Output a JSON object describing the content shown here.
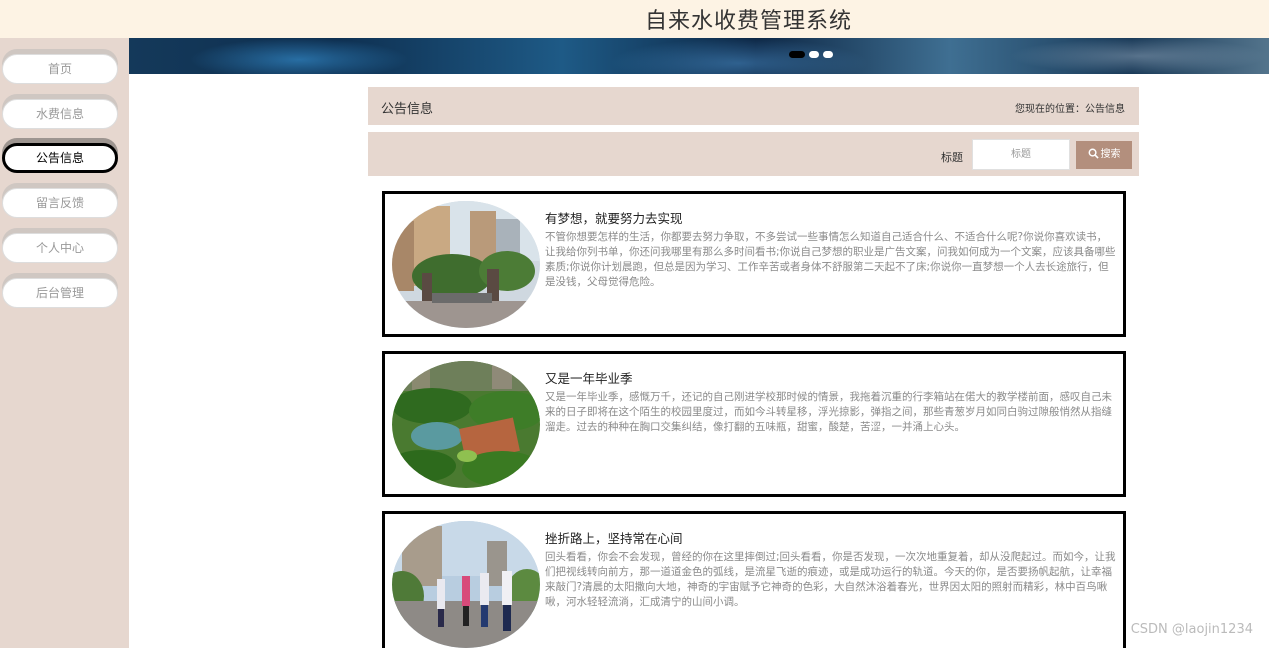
{
  "header": {
    "title": "自来水收费管理系统"
  },
  "sidebar": {
    "items": [
      {
        "label": "首页"
      },
      {
        "label": "水费信息"
      },
      {
        "label": "公告信息"
      },
      {
        "label": "留言反馈"
      },
      {
        "label": "个人中心"
      },
      {
        "label": "后台管理"
      }
    ],
    "active_index": 2
  },
  "banner": {
    "slide_count": 3,
    "active_slide": 1
  },
  "breadcrumb": {
    "title": "公告信息",
    "location": "您现在的位置：公告信息"
  },
  "search": {
    "label": "标题",
    "placeholder": "标题",
    "button_label": "搜索"
  },
  "articles": [
    {
      "title": "有梦想，就要努力去实现",
      "excerpt": "不管你想要怎样的生活，你都要去努力争取，不多尝试一些事情怎么知道自己适合什么、不适合什么呢?你说你喜欢读书，让我给你列书单，你还问我哪里有那么多时间看书;你说自己梦想的职业是广告文案，问我如何成为一个文案，应该具备哪些素质;你说你计划晨跑，但总是因为学习、工作辛苦或者身体不舒服第二天起不了床;你说你一直梦想一个人去长途旅行，但是没钱，父母觉得危险。",
      "image": "residential-gate-photo"
    },
    {
      "title": "又是一年毕业季",
      "excerpt": "又是一年毕业季，感慨万千，还记的自己刚进学校那时候的情景，我拖着沉重的行李箱站在偌大的教学楼前面，感叹自己未来的日子即将在这个陌生的校园里度过，而如今斗转星移，浮光掠影，弹指之间，那些青葱岁月如同白驹过隙般悄然从指缝溜走。过去的种种在胸口交集纠结，像打翻的五味瓶，甜蜜，酸楚，苦涩，一并涌上心头。",
      "image": "garden-pond-photo"
    },
    {
      "title": "挫折路上，坚持常在心间",
      "excerpt": "回头看看，你会不会发现，曾经的你在这里摔倒过;回头看看，你是否发现，一次次地重复着，却从没爬起过。而如今，让我们把视线转向前方，那一道道金色的弧线，是流星飞逝的痕迹，或是成功运行的轨道。今天的你，是否要扬帆起航，让幸福来敲门?清晨的太阳撒向大地，神奇的宇宙赋予它神奇的色彩，大自然沐浴着春光，世界因太阳的照射而精彩，林中百鸟啾啾，河水轻轻流淌，汇成清宁的山间小调。",
      "image": "people-walking-photo"
    }
  ],
  "watermark": "CSDN @laojin1234"
}
